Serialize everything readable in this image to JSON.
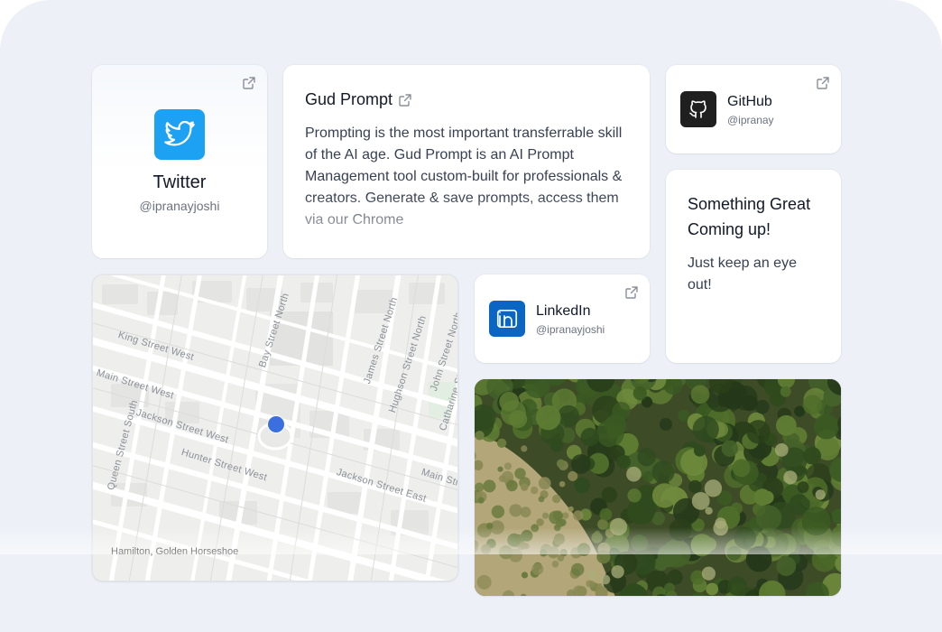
{
  "twitter": {
    "name": "Twitter",
    "handle": "@ipranayjoshi"
  },
  "gud_prompt": {
    "title": "Gud Prompt",
    "description": "Prompting is the most important transferrable skill of the AI age. Gud Prompt is an AI Prompt Management tool custom-built for professionals & creators. Generate & save prompts, access them via our Chrome"
  },
  "github": {
    "name": "GitHub",
    "handle": "@ipranay"
  },
  "coming_soon": {
    "title": "Something Great Coming up!",
    "description": "Just keep an eye out!"
  },
  "linkedin": {
    "name": "LinkedIn",
    "handle": "@ipranayjoshi"
  },
  "map": {
    "streets": [
      "King Street West",
      "Main Street West",
      "Jackson Street West",
      "Hunter Street West",
      "Bay Street North",
      "James Street North",
      "Hughson Street North",
      "John Street North",
      "Catharine Street",
      "Queen Street South",
      "Jackson Street East",
      "Main Street East"
    ],
    "location_label": "Hamilton, Golden Horseshoe"
  },
  "colors": {
    "twitter": "#1da1f2",
    "github": "#1f1f1f",
    "linkedin": "#0a66c2",
    "map_pin": "#3b6fe0",
    "page_bg": "#edf1f7"
  },
  "icons": {
    "twitter": "twitter-bird-icon",
    "github": "github-octocat-icon",
    "linkedin": "linkedin-in-icon",
    "external": "external-link-icon"
  }
}
